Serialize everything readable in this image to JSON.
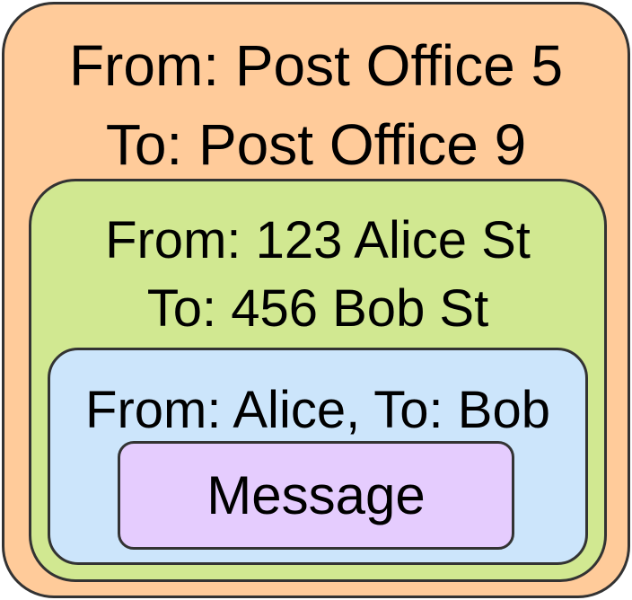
{
  "colors": {
    "outer_fill": "#ffcb9a",
    "middle_fill": "#d1e891",
    "inner_fill": "#cce5fb",
    "message_fill": "#e5ccfe",
    "border": "#333333"
  },
  "outer_envelope": {
    "from_line": "From: Post Office 5",
    "to_line": "To: Post Office 9"
  },
  "middle_envelope": {
    "from_line": "From: 123 Alice St",
    "to_line": "To: 456 Bob St"
  },
  "inner_envelope": {
    "header_line": "From: Alice, To: Bob"
  },
  "message": {
    "label": "Message"
  }
}
